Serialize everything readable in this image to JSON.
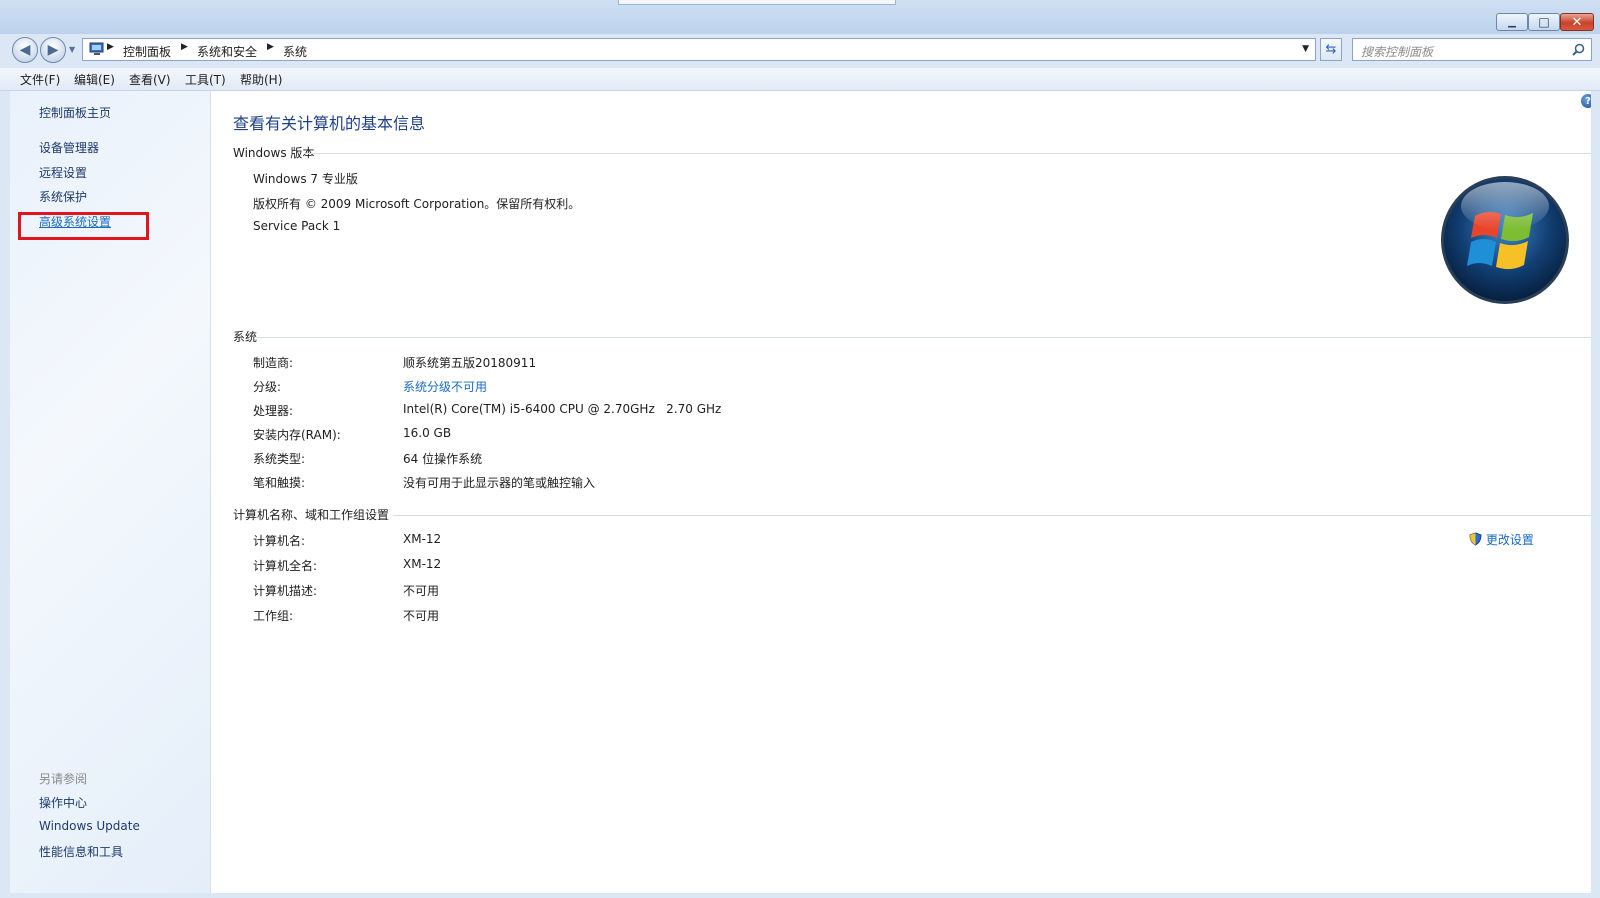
{
  "window": {
    "minimize": "▁",
    "maximize": "□",
    "close": "✕"
  },
  "address": {
    "breadcrumbs": [
      "控制面板",
      "系统和安全",
      "系统"
    ],
    "search_placeholder": "搜索控制面板"
  },
  "menu": [
    "文件(F)",
    "编辑(E)",
    "查看(V)",
    "工具(T)",
    "帮助(H)"
  ],
  "sidebar": {
    "home": "控制面板主页",
    "items": [
      "设备管理器",
      "远程设置",
      "系统保护",
      "高级系统设置"
    ],
    "see_also_label": "另请参阅",
    "see_also": [
      "操作中心",
      "Windows Update",
      "性能信息和工具"
    ]
  },
  "main": {
    "title": "查看有关计算机的基本信息",
    "edition": {
      "header": "Windows 版本",
      "name": "Windows 7 专业版",
      "copyright": "版权所有 © 2009 Microsoft Corporation。保留所有权利。",
      "service_pack": "Service Pack 1"
    },
    "system": {
      "header": "系统",
      "rows": [
        {
          "label": "制造商:",
          "value": "顺系统第五版20180911"
        },
        {
          "label": "分级:",
          "value": "系统分级不可用"
        },
        {
          "label": "处理器:",
          "value": "Intel(R) Core(TM) i5-6400 CPU @ 2.70GHz   2.70 GHz"
        },
        {
          "label": "安装内存(RAM):",
          "value": "16.0 GB"
        },
        {
          "label": "系统类型:",
          "value": "64 位操作系统"
        },
        {
          "label": "笔和触摸:",
          "value": "没有可用于此显示器的笔或触控输入"
        }
      ]
    },
    "computer": {
      "header": "计算机名称、域和工作组设置",
      "change_settings": "更改设置",
      "rows": [
        {
          "label": "计算机名:",
          "value": "XM-12"
        },
        {
          "label": "计算机全名:",
          "value": "XM-12"
        },
        {
          "label": "计算机描述:",
          "value": "不可用"
        },
        {
          "label": "工作组:",
          "value": "不可用"
        }
      ]
    }
  },
  "colors": {
    "link": "#1a6bc7",
    "title": "#1e3f8a",
    "highlight_box": "#e3151c"
  },
  "icons": [
    "back-arrow-icon",
    "forward-arrow-icon",
    "computer-icon",
    "refresh-icon",
    "search-icon",
    "help-icon",
    "shield-icon",
    "windows-logo"
  ]
}
